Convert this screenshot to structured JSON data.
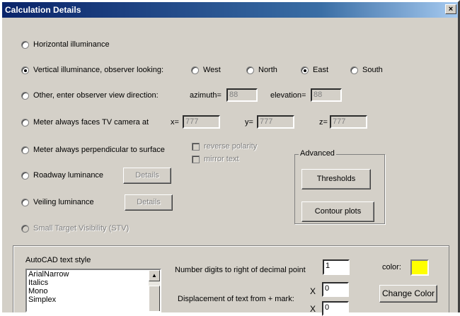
{
  "window": {
    "title": "Calculation Details",
    "close_label": "×"
  },
  "options": {
    "horizontal": "Horizontal illuminance",
    "vertical": "Vertical illuminance, observer looking:",
    "other": "Other, enter observer view direction:",
    "meter_tv": "Meter always faces TV camera at",
    "meter_perp": "Meter always perpendicular to surface",
    "roadway": "Roadway luminance",
    "veiling": "Veiling luminance",
    "stv": "Small Target Visibility (STV)",
    "selected": "vertical"
  },
  "directions": {
    "west": "West",
    "north": "North",
    "east": "East",
    "south": "South",
    "selected": "east"
  },
  "view_direction": {
    "azimuth_label": "azimuth=",
    "azimuth_value": "88",
    "elevation_label": "elevation=",
    "elevation_value": "88"
  },
  "tv_camera": {
    "x_label": "x=",
    "x_value": "777",
    "y_label": "y=",
    "y_value": "777",
    "z_label": "z=",
    "z_value": "777"
  },
  "checkboxes": {
    "reverse_polarity": "reverse polarity",
    "mirror_text": "mirror text"
  },
  "buttons": {
    "roadway_details": "Details",
    "veiling_details": "Details",
    "thresholds": "Thresholds",
    "contour_plots": "Contour plots",
    "change_color": "Change Color"
  },
  "advanced": {
    "label": "Advanced"
  },
  "autocad": {
    "style_label": "AutoCAD text style",
    "styles": [
      "ArialNarrow",
      "Italics",
      "Mono",
      "Simplex"
    ],
    "digits_label": "Number digits to right of decimal point",
    "digits_value": "1",
    "displacement_label": "Displacement of text from + mark:",
    "x_mark": "X",
    "x_value": "0",
    "y_value": "0",
    "color_label": "color:",
    "color": "#ffff00"
  }
}
